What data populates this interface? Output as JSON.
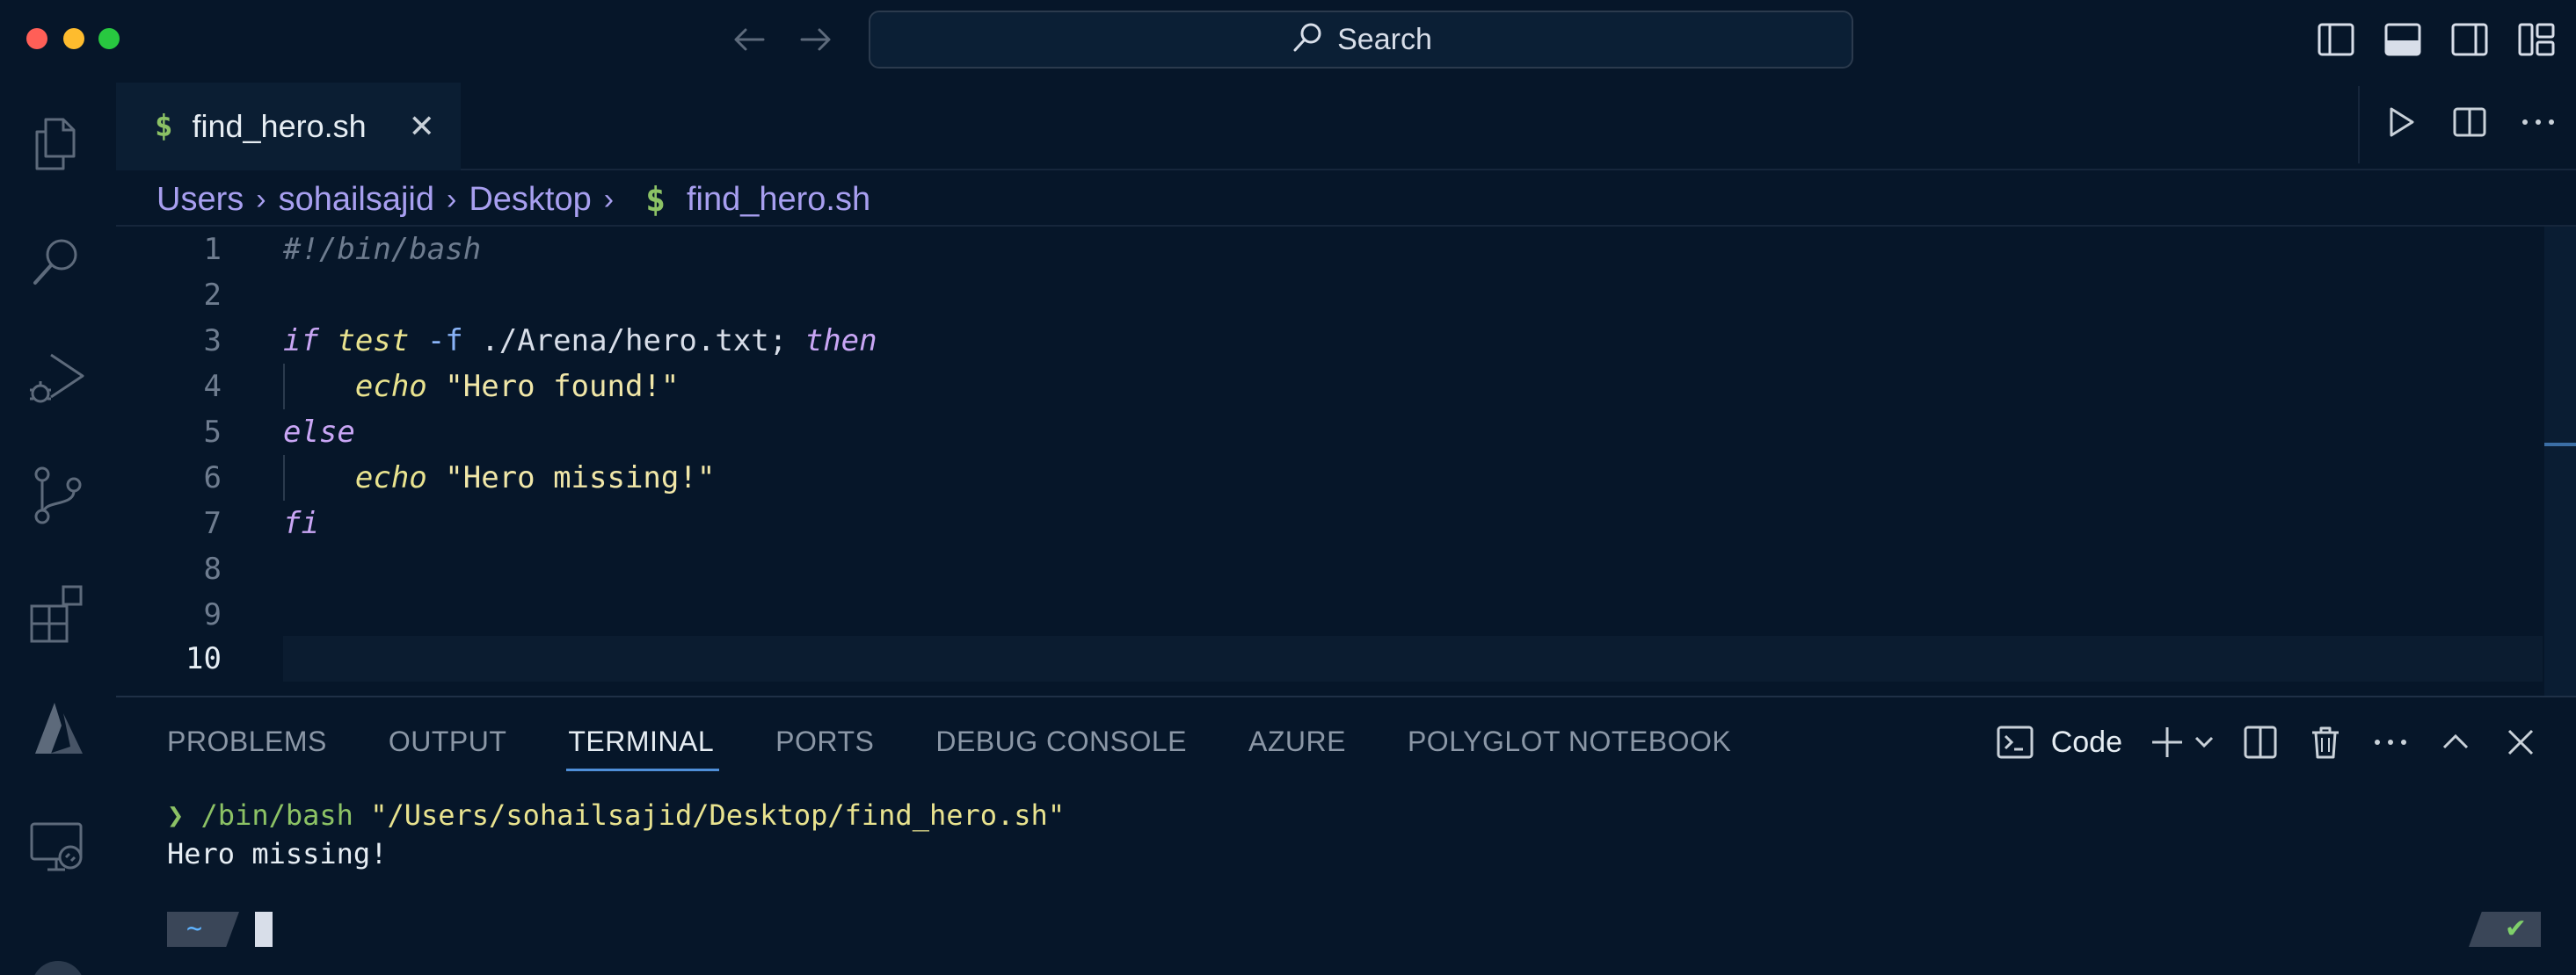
{
  "titlebar": {
    "search_label": "Search"
  },
  "tab": {
    "file_icon": "$",
    "file_name": "find_hero.sh",
    "close_glyph": "✕"
  },
  "breadcrumb": {
    "items": [
      "Users",
      "sohailsajid",
      "Desktop"
    ],
    "file_icon": "$",
    "file": "find_hero.sh"
  },
  "editor": {
    "line_numbers": [
      "1",
      "2",
      "3",
      "4",
      "5",
      "6",
      "7",
      "8",
      "9",
      "10"
    ],
    "active_line": "10",
    "lines": {
      "l1_comment": "#!/bin/bash",
      "l3_if": "if",
      "l3_test": "test",
      "l3_flag": "-f",
      "l3_path": "./Arena/hero.txt",
      "l3_semicolon": ";",
      "l3_then": "then",
      "l4_echo": "echo",
      "l4_str": "\"Hero found!\"",
      "l5_else": "else",
      "l6_echo": "echo",
      "l6_str": "\"Hero missing!\"",
      "l7_fi": "fi"
    }
  },
  "panel": {
    "tabs": [
      "PROBLEMS",
      "OUTPUT",
      "TERMINAL",
      "PORTS",
      "DEBUG CONSOLE",
      "AZURE",
      "POLYGLOT NOTEBOOK"
    ],
    "active_tab": "TERMINAL",
    "terminal_name": "Code"
  },
  "terminal": {
    "prompt_glyph": "❯",
    "command": "/bin/bash",
    "argument": "\"/Users/sohailsajid/Desktop/find_hero.sh\"",
    "output": "Hero missing!",
    "cwd_segment": "~",
    "status_glyph": "✔"
  },
  "colors": {
    "background": "#061629",
    "accent": "#4f8fd8",
    "keyword": "#c9a6f5",
    "string": "#f1e7a8",
    "function": "#e9e38f",
    "shell_icon": "#8cc265"
  }
}
